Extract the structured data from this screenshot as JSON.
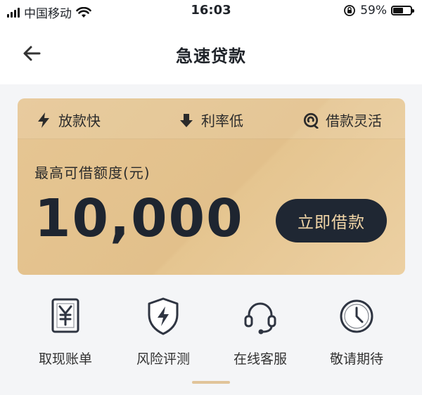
{
  "status_bar": {
    "carrier": "中国移动",
    "time": "16:03",
    "battery": "59%",
    "battery_level": 0.59,
    "icons": [
      "signal-icon",
      "wifi-icon",
      "rotation-lock-icon",
      "battery-icon"
    ]
  },
  "header": {
    "title": "急速贷款",
    "back_icon": "back-arrow-icon"
  },
  "card": {
    "features": [
      {
        "label": "放款快",
        "icon": "lightning-icon"
      },
      {
        "label": "利率低",
        "icon": "down-arrow-icon"
      },
      {
        "label": "借款灵活",
        "icon": "flexible-icon"
      }
    ],
    "limit_label": "最高可借额度(元)",
    "amount": "10,000",
    "button_label": "立即借款",
    "colors": {
      "card_gold": "#e3c18c",
      "button_dark": "#1f2733",
      "button_text": "#f2d6a7"
    }
  },
  "shortcuts": [
    {
      "label": "取现账单",
      "icon": "yuan-bill-icon"
    },
    {
      "label": "风险评测",
      "icon": "shield-lightning-icon"
    },
    {
      "label": "在线客服",
      "icon": "headset-icon"
    },
    {
      "label": "敬请期待",
      "icon": "clock-icon"
    }
  ]
}
